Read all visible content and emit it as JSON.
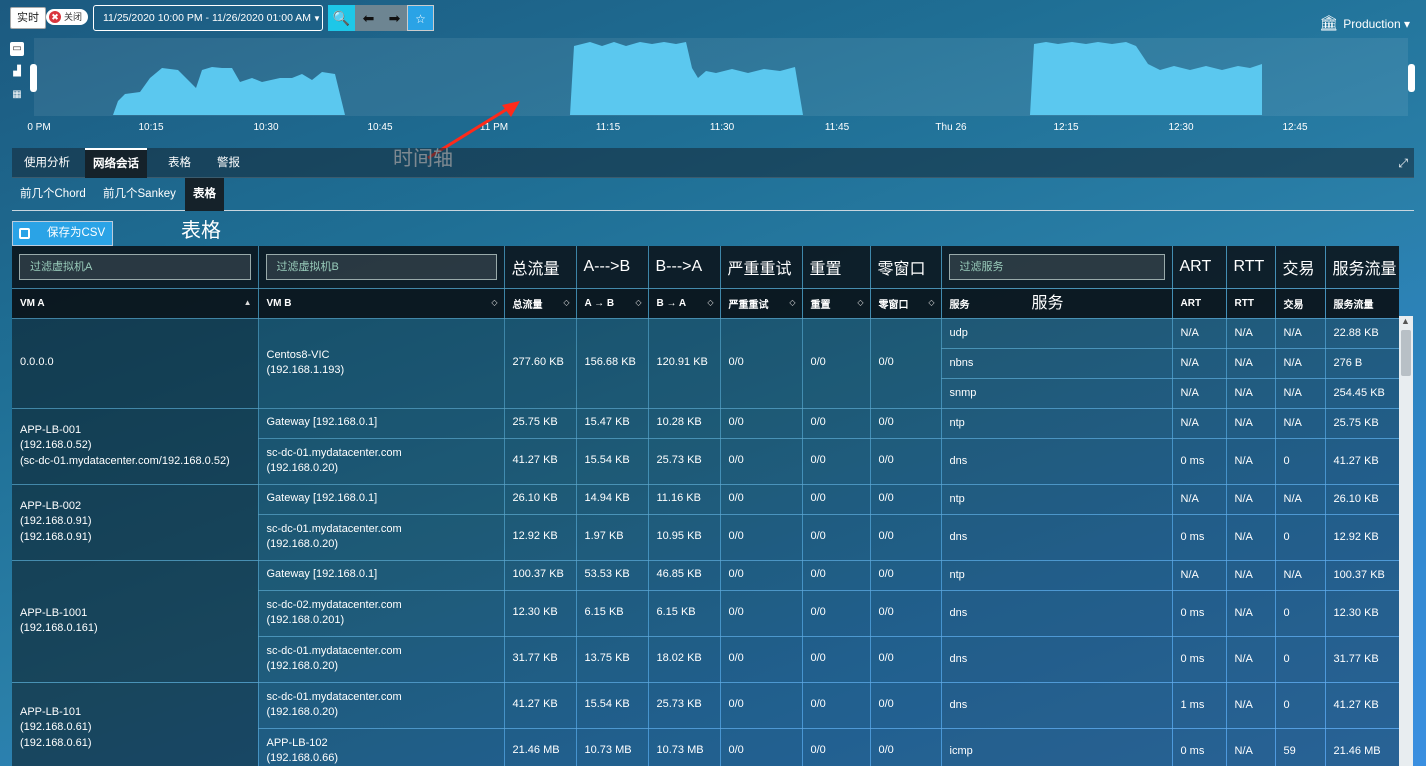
{
  "topbar": {
    "realtime_label": "实时",
    "toggle_label": "关闭",
    "time_range": "11/25/2020 10:00 PM - 11/26/2020 01:00 AM",
    "production_label": "Production"
  },
  "timeline": {
    "axis_labels": [
      "0 PM",
      "10:15",
      "10:30",
      "10:45",
      "11 PM",
      "11:15",
      "11:30",
      "11:45",
      "Thu 26",
      "12:15",
      "12:30",
      "12:45"
    ],
    "annotation": "时间轴",
    "fill_color": "#5bc8ef"
  },
  "tabs": [
    "使用分析",
    "网络会话",
    "表格",
    "警报"
  ],
  "subtabs": [
    "前几个Chord",
    "前几个Sankey",
    "表格"
  ],
  "table_annotation": "表格",
  "csv_button": "保存为CSV",
  "filters": {
    "vm_a": "过滤虚拟机A",
    "vm_b": "过滤虚拟机B",
    "service": "过滤服务"
  },
  "filter_row_labels": {
    "total": "总流量",
    "a_to_b": "A--->B",
    "b_to_a": "B--->A",
    "retrans": "严重重试",
    "reset": "重置",
    "zero_win": "零窗口",
    "art": "ART",
    "rtt": "RTT",
    "txn": "交易",
    "svc_traffic": "服务流量"
  },
  "headers": {
    "vm_a": "VM A",
    "vm_b": "VM B",
    "total": "总流量",
    "a_to_b": "A → B",
    "b_to_a": "B → A",
    "retrans": "严重重试",
    "reset": "重置",
    "zero_win": "零窗口",
    "service": "服务",
    "service_anno": "服务",
    "art": "ART",
    "rtt": "RTT",
    "txn": "交易",
    "svc_traffic": "服务流量"
  },
  "groups": [
    {
      "vm_a": "0.0.0.0",
      "b_rows": [
        {
          "vm_b": "Centos8-VIC\n(192.168.1.193)",
          "total": "277.60 KB",
          "a_to_b": "156.68 KB",
          "b_to_a": "120.91 KB",
          "retrans": "0/0",
          "reset": "0/0",
          "zero_win": "0/0",
          "services": [
            {
              "service": "udp",
              "art": "N/A",
              "rtt": "N/A",
              "txn": "N/A",
              "traffic": "22.88 KB"
            },
            {
              "service": "nbns",
              "art": "N/A",
              "rtt": "N/A",
              "txn": "N/A",
              "traffic": "276 B"
            },
            {
              "service": "snmp",
              "art": "N/A",
              "rtt": "N/A",
              "txn": "N/A",
              "traffic": "254.45 KB"
            }
          ]
        }
      ]
    },
    {
      "vm_a": "APP-LB-001\n(192.168.0.52)\n(sc-dc-01.mydatacenter.com/192.168.0.52)",
      "b_rows": [
        {
          "vm_b": "Gateway [192.168.0.1]",
          "total": "25.75 KB",
          "a_to_b": "15.47 KB",
          "b_to_a": "10.28 KB",
          "retrans": "0/0",
          "reset": "0/0",
          "zero_win": "0/0",
          "services": [
            {
              "service": "ntp",
              "art": "N/A",
              "rtt": "N/A",
              "txn": "N/A",
              "traffic": "25.75 KB"
            }
          ]
        },
        {
          "vm_b": "sc-dc-01.mydatacenter.com\n(192.168.0.20)",
          "total": "41.27 KB",
          "a_to_b": "15.54 KB",
          "b_to_a": "25.73 KB",
          "retrans": "0/0",
          "reset": "0/0",
          "zero_win": "0/0",
          "services": [
            {
              "service": "dns",
              "art": "0 ms",
              "rtt": "N/A",
              "txn": "0",
              "traffic": "41.27 KB"
            }
          ]
        }
      ]
    },
    {
      "vm_a": "APP-LB-002\n(192.168.0.91)\n(192.168.0.91)",
      "b_rows": [
        {
          "vm_b": "Gateway [192.168.0.1]",
          "total": "26.10 KB",
          "a_to_b": "14.94 KB",
          "b_to_a": "11.16 KB",
          "retrans": "0/0",
          "reset": "0/0",
          "zero_win": "0/0",
          "services": [
            {
              "service": "ntp",
              "art": "N/A",
              "rtt": "N/A",
              "txn": "N/A",
              "traffic": "26.10 KB"
            }
          ]
        },
        {
          "vm_b": "sc-dc-01.mydatacenter.com\n(192.168.0.20)",
          "total": "12.92 KB",
          "a_to_b": "1.97 KB",
          "b_to_a": "10.95 KB",
          "retrans": "0/0",
          "reset": "0/0",
          "zero_win": "0/0",
          "services": [
            {
              "service": "dns",
              "art": "0 ms",
              "rtt": "N/A",
              "txn": "0",
              "traffic": "12.92 KB"
            }
          ]
        }
      ]
    },
    {
      "vm_a": "APP-LB-1001\n(192.168.0.161)",
      "b_rows": [
        {
          "vm_b": "Gateway [192.168.0.1]",
          "total": "100.37 KB",
          "a_to_b": "53.53 KB",
          "b_to_a": "46.85 KB",
          "retrans": "0/0",
          "reset": "0/0",
          "zero_win": "0/0",
          "services": [
            {
              "service": "ntp",
              "art": "N/A",
              "rtt": "N/A",
              "txn": "N/A",
              "traffic": "100.37 KB"
            }
          ]
        },
        {
          "vm_b": "sc-dc-02.mydatacenter.com\n(192.168.0.201)",
          "total": "12.30 KB",
          "a_to_b": "6.15 KB",
          "b_to_a": "6.15 KB",
          "retrans": "0/0",
          "reset": "0/0",
          "zero_win": "0/0",
          "services": [
            {
              "service": "dns",
              "art": "0 ms",
              "rtt": "N/A",
              "txn": "0",
              "traffic": "12.30 KB"
            }
          ]
        },
        {
          "vm_b": "sc-dc-01.mydatacenter.com\n(192.168.0.20)",
          "total": "31.77 KB",
          "a_to_b": "13.75 KB",
          "b_to_a": "18.02 KB",
          "retrans": "0/0",
          "reset": "0/0",
          "zero_win": "0/0",
          "services": [
            {
              "service": "dns",
              "art": "0 ms",
              "rtt": "N/A",
              "txn": "0",
              "traffic": "31.77 KB"
            }
          ]
        }
      ]
    },
    {
      "vm_a": "APP-LB-101\n(192.168.0.61)\n(192.168.0.61)",
      "b_rows": [
        {
          "vm_b": "sc-dc-01.mydatacenter.com\n(192.168.0.20)",
          "total": "41.27 KB",
          "a_to_b": "15.54 KB",
          "b_to_a": "25.73 KB",
          "retrans": "0/0",
          "reset": "0/0",
          "zero_win": "0/0",
          "services": [
            {
              "service": "dns",
              "art": "1 ms",
              "rtt": "N/A",
              "txn": "0",
              "traffic": "41.27 KB"
            }
          ]
        },
        {
          "vm_b": "APP-LB-102\n(192.168.0.66)",
          "total": "21.46 MB",
          "a_to_b": "10.73 MB",
          "b_to_a": "10.73 MB",
          "retrans": "0/0",
          "reset": "0/0",
          "zero_win": "0/0",
          "services": [
            {
              "service": "icmp",
              "art": "0 ms",
              "rtt": "N/A",
              "txn": "59",
              "traffic": "21.46 MB"
            }
          ]
        }
      ]
    }
  ]
}
